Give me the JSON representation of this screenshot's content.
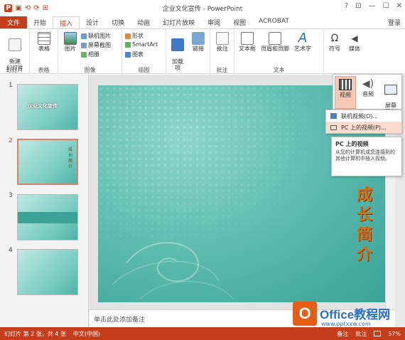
{
  "window": {
    "title": "企业文化宣传 - PowerPoint",
    "controls": [
      "?",
      "⊡",
      "—",
      "☐",
      "✕"
    ]
  },
  "qat": [
    "⟲",
    "⟳",
    "⊞"
  ],
  "tabs": [
    "文件",
    "开始",
    "插入",
    "设计",
    "切换",
    "动画",
    "幻灯片放映",
    "审阅",
    "视图",
    "ACROBAT"
  ],
  "login": "登录",
  "ribbon": {
    "groups": [
      {
        "label": "幻灯片",
        "buttons": [
          "新建\n幻灯片"
        ]
      },
      {
        "label": "表格",
        "buttons": [
          "表格"
        ]
      },
      {
        "label": "图像",
        "buttons": [
          "图片"
        ],
        "small": [
          "联机图片",
          "屏幕截图",
          "相册"
        ]
      },
      {
        "label": "插图",
        "small": [
          "形状",
          "SmartArt",
          "图表"
        ]
      },
      {
        "label": "",
        "buttons": [
          "加载\n项",
          "链接"
        ]
      },
      {
        "label": "批注",
        "buttons": [
          "批注"
        ]
      },
      {
        "label": "文本",
        "buttons": [
          "文本框",
          "页眉和页脚",
          "艺术字"
        ]
      },
      {
        "label": "",
        "buttons": [
          "符号",
          "媒体"
        ]
      }
    ]
  },
  "media_dropdown": {
    "buttons": [
      "视频",
      "音频",
      "屏幕\n录制"
    ],
    "menu": [
      "联机视频(O)...",
      "PC 上的视频(P)..."
    ],
    "tooltip_title": "PC 上的视频",
    "tooltip_desc": "从您的计算机或您连接到的其他计算机中插入视频。"
  },
  "slides": [
    {
      "number": "1",
      "caption": "企业文化宣传"
    },
    {
      "number": "2",
      "caption": "成长简介"
    },
    {
      "number": "3",
      "caption": ""
    },
    {
      "number": "4",
      "caption": ""
    }
  ],
  "main_slide": {
    "vertical_title": "成长简介"
  },
  "notes": {
    "placeholder": "单击此处添加备注"
  },
  "statusbar": {
    "slide_info": "幻灯片 第 2 张，共 4 张",
    "lang": "中文(中国)",
    "notes_btn": "备注",
    "comments_btn": "批注",
    "zoom": "57%"
  },
  "watermark": {
    "logo": "O",
    "text": "Office教程网",
    "url": "www.pptxxw.com"
  },
  "colors": {
    "accent": "#c43e1c",
    "slide_teal": "#5fbdb1",
    "title_orange": "#d3711a"
  }
}
